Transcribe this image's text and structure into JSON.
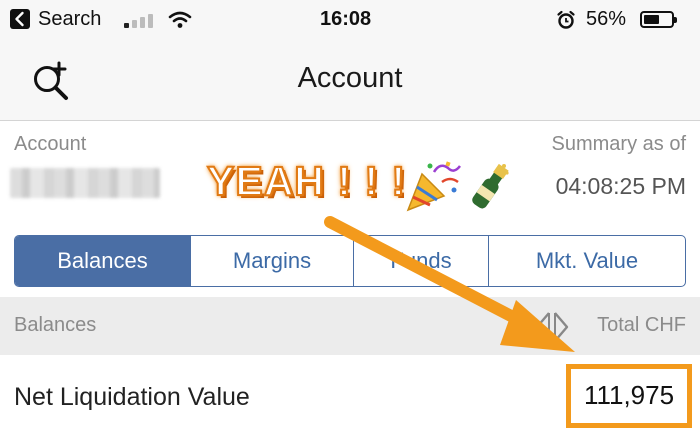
{
  "status_bar": {
    "back_label": "Search",
    "time": "16:08",
    "battery_percent": "56%",
    "battery_level": 0.56,
    "signal_bars_active": 1,
    "signal_bars_total": 4
  },
  "nav": {
    "title": "Account",
    "left_icon": "search-add-icon"
  },
  "account": {
    "label": "Account",
    "summary_label": "Summary as of",
    "summary_time": "04:08:25 PM"
  },
  "annotation": {
    "text": "YEAH ! ! !",
    "stickers": [
      "party-popper-icon",
      "champagne-icon"
    ],
    "accent_color": "#f39a1c"
  },
  "tabs": [
    {
      "label": "Balances",
      "active": true
    },
    {
      "label": "Margins",
      "active": false
    },
    {
      "label": "Funds",
      "active": false
    },
    {
      "label": "Mkt. Value",
      "active": false
    }
  ],
  "balances": {
    "section_label": "Balances",
    "currency_toggle_icon": "currency-toggle-icon",
    "currency_label": "Total CHF"
  },
  "net_liquidation": {
    "label": "Net Liquidation Value",
    "value": "111,975"
  },
  "colors": {
    "tab_accent": "#4a6ea5",
    "highlight": "#f39a1c"
  }
}
